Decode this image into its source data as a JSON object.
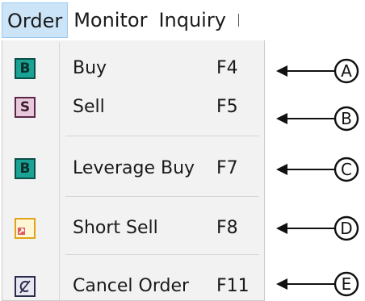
{
  "menubar": {
    "items": [
      {
        "label": "Order"
      },
      {
        "label": "Monitor"
      },
      {
        "label": "Inquiry"
      }
    ]
  },
  "order_menu": {
    "items": [
      {
        "icon_text": "B",
        "icon": "buy-icon",
        "label": "Buy",
        "shortcut": "F4"
      },
      {
        "icon_text": "S",
        "icon": "sell-icon",
        "label": "Sell",
        "shortcut": "F5"
      },
      {
        "icon_text": "B",
        "icon": "leverage-buy-icon",
        "label": "Leverage Buy",
        "shortcut": "F7"
      },
      {
        "icon_text": "",
        "icon": "short-sell-icon",
        "label": "Short Sell",
        "shortcut": "F8"
      },
      {
        "icon_text": "",
        "icon": "cancel-order-icon",
        "label": "Cancel Order",
        "shortcut": "F11"
      }
    ]
  },
  "callouts": [
    "A",
    "B",
    "C",
    "D",
    "E"
  ],
  "colors": {
    "menu_highlight": "#cce4f7",
    "menu_background": "#f2f2f2",
    "buy_icon": "#1aa294",
    "sell_icon": "#e8c9dc",
    "short_sell_icon": "#e0a41b"
  }
}
